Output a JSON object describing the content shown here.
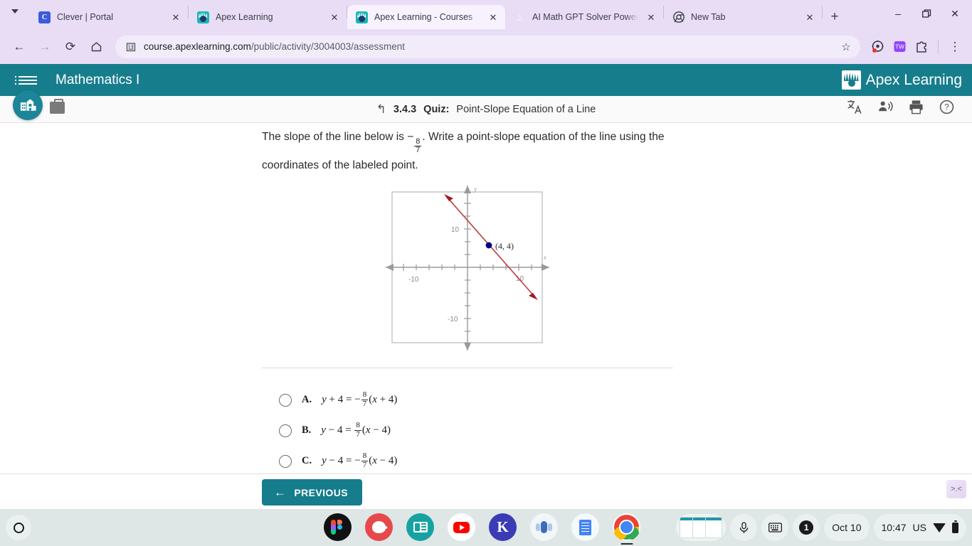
{
  "browser": {
    "tabs": [
      {
        "title": "Clever | Portal",
        "favicon": "clever-icon",
        "active": false
      },
      {
        "title": "Apex Learning",
        "favicon": "apex-icon",
        "active": false
      },
      {
        "title": "Apex Learning - Courses",
        "favicon": "apex-icon",
        "active": true
      },
      {
        "title": "AI Math GPT Solver Powere",
        "favicon": "compass-icon",
        "active": false
      },
      {
        "title": "New Tab",
        "favicon": "chrome-icon",
        "active": false
      }
    ],
    "new_tab_label": "+",
    "window_controls": {
      "minimize": "–",
      "restore": "❐",
      "close": "✕"
    },
    "toolbar": {
      "back_label": "←",
      "forward_label": "→",
      "reload_label": "⟳",
      "home_label": "⌂",
      "url_domain": "course.apexlearning.com",
      "url_path": "/public/activity/3004003/assessment",
      "bookmark_label": "☆",
      "menu_label": "⋮"
    }
  },
  "apex": {
    "course_title": "Mathematics I",
    "brand_name": "Apex Learning",
    "brand_tm": "®",
    "activity": {
      "number": "3.4.3",
      "type": "Quiz:",
      "name": "Point-Slope Equation of a Line"
    },
    "activity_icons": [
      {
        "name": "translate-icon",
        "glyph": "文A"
      },
      {
        "name": "read-aloud-icon",
        "glyph": "🗣"
      },
      {
        "name": "print-icon",
        "glyph": "⎙"
      },
      {
        "name": "help-icon",
        "glyph": "?"
      }
    ],
    "theme_color": "#167d8c"
  },
  "question": {
    "part1": "The slope of the line below is",
    "minus": "−",
    "fraction": {
      "numerator": "8",
      "denominator": "7"
    },
    "part2": ". Write a point-slope equation of the line using the coordinates of the labeled point."
  },
  "chart_data": {
    "type": "line",
    "title": "",
    "xlabel": "x",
    "ylabel": "y",
    "xlim": [
      -14,
      14
    ],
    "ylim": [
      -14,
      14
    ],
    "xticks": [
      -10,
      10
    ],
    "yticks": [
      10,
      -10
    ],
    "tick_spacing": 2,
    "grid": false,
    "series": [
      {
        "name": "line",
        "color": "#b5393f",
        "slope": -1.1428571,
        "point_slope_through": [
          4,
          4
        ],
        "endpoints": [
          [
            -2.6,
            12.2
          ],
          [
            10.7,
            -7.0
          ]
        ],
        "arrows": "both"
      }
    ],
    "points": [
      {
        "x": 4,
        "y": 4,
        "label": "(4, 4)",
        "color": "#00008b"
      }
    ]
  },
  "options": [
    {
      "letter": "A.",
      "lhs_var": "y",
      "lhs_op": "+",
      "lhs_num": "4",
      "eq": "=",
      "rhs_sign": "−",
      "num": "8",
      "den": "7",
      "paren_var": "x",
      "paren_op": "+",
      "paren_num": "4"
    },
    {
      "letter": "B.",
      "lhs_var": "y",
      "lhs_op": "−",
      "lhs_num": "4",
      "eq": "=",
      "rhs_sign": "",
      "num": "8",
      "den": "7",
      "paren_var": "x",
      "paren_op": "−",
      "paren_num": "4"
    },
    {
      "letter": "C.",
      "lhs_var": "y",
      "lhs_op": "−",
      "lhs_num": "4",
      "eq": "=",
      "rhs_sign": "−",
      "num": "8",
      "den": "7",
      "paren_var": "x",
      "paren_op": "−",
      "paren_num": "4"
    }
  ],
  "action_bar": {
    "previous_label": "PREVIOUS",
    "previous_arrow": "←",
    "collapse_label": ">.<"
  },
  "shelf": {
    "apps": [
      {
        "name": "figma",
        "label": ""
      },
      {
        "name": "canva",
        "label": ""
      },
      {
        "name": "news",
        "label": ""
      },
      {
        "name": "youtube",
        "label": ""
      },
      {
        "name": "kami",
        "label": "K"
      },
      {
        "name": "microphone",
        "label": ""
      },
      {
        "name": "google-docs",
        "label": ""
      },
      {
        "name": "chrome",
        "label": "",
        "running": true
      }
    ],
    "tray": {
      "mic_glyph": "ᵓ",
      "keyboard_glyph": "⌨",
      "notification_count": "1",
      "date": "Oct 10",
      "time": "10:47",
      "locale": "US"
    }
  }
}
